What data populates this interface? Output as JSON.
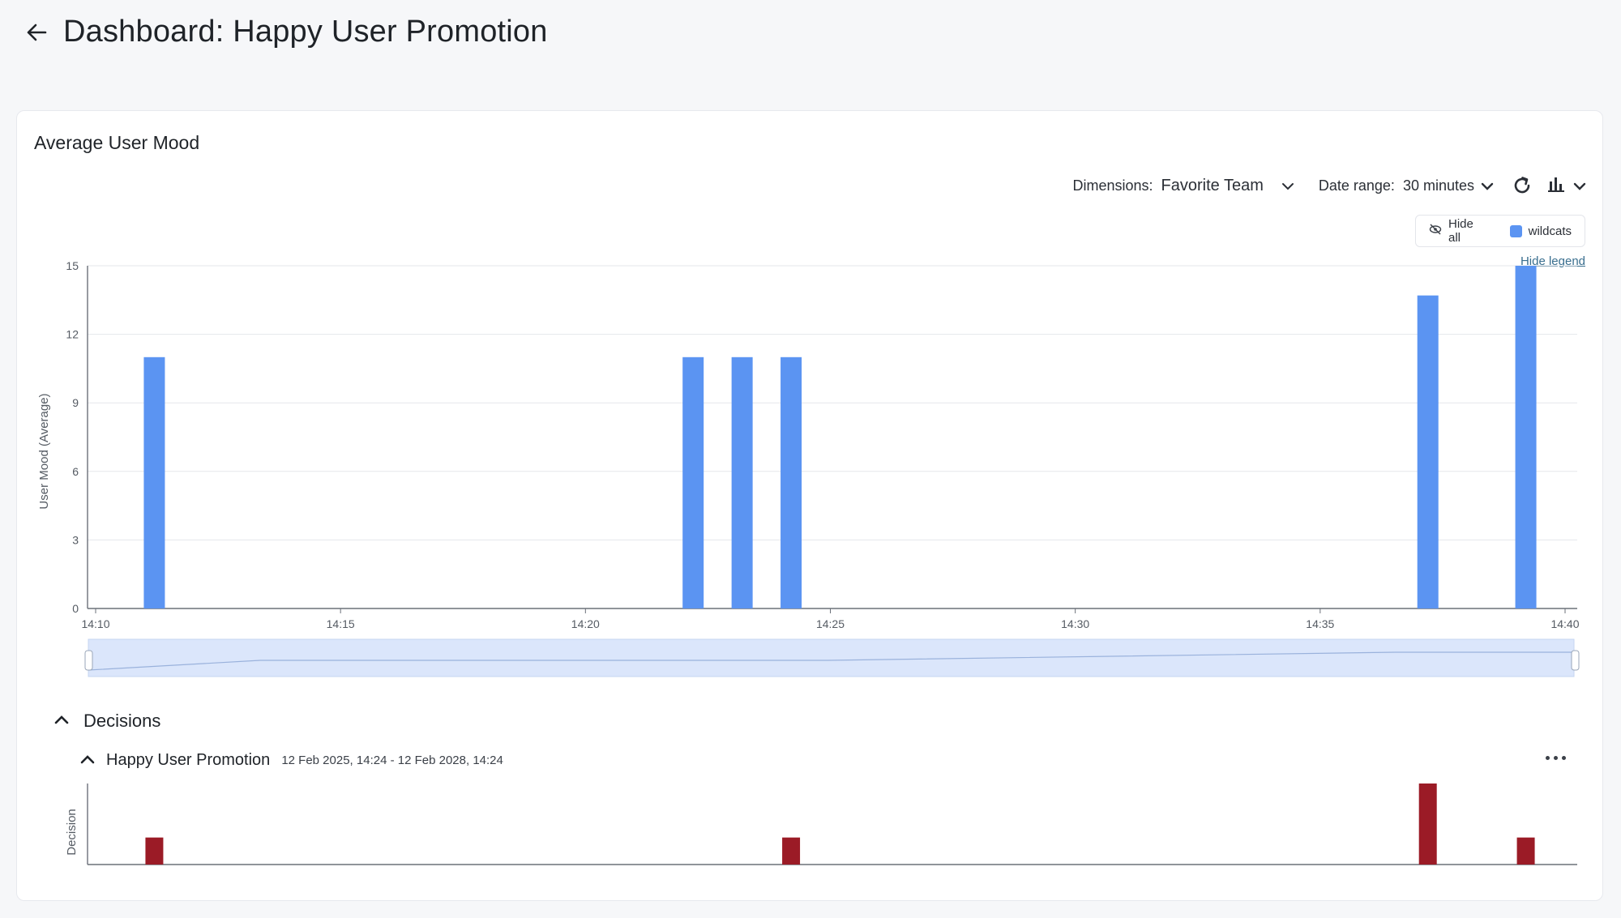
{
  "header": {
    "title": "Dashboard: Happy User Promotion"
  },
  "card": {
    "title": "Average User Mood",
    "toolbar": {
      "dimensions_label": "Dimensions:",
      "dimensions_value": "Favorite Team",
      "date_range_label": "Date range:",
      "date_range_value": "30 minutes"
    },
    "legend": {
      "hide_all_label": "Hide all",
      "series_label": "wildcats",
      "hide_legend_label": "Hide legend"
    }
  },
  "colors": {
    "accent": "#5b94f2",
    "decision": "#9b1b26",
    "grid": "#e5e7eb",
    "axis": "#9aa0a8",
    "navigator": "#dbe6fb"
  },
  "chart_data": [
    {
      "type": "bar",
      "ylabel": "User Mood (Average)",
      "ylim": [
        0,
        15
      ],
      "yticks": [
        0,
        3,
        6,
        9,
        12,
        15
      ],
      "xlim": [
        "14:10",
        "14:40"
      ],
      "xticks": [
        "14:10",
        "14:15",
        "14:20",
        "14:25",
        "14:30",
        "14:35",
        "14:40"
      ],
      "grid": true,
      "legend": "top-right",
      "series": [
        {
          "name": "wildcats",
          "color": "#5b94f2",
          "points": [
            {
              "x": "14:11",
              "y": 11
            },
            {
              "x": "14:22",
              "y": 11
            },
            {
              "x": "14:23",
              "y": 11
            },
            {
              "x": "14:24",
              "y": 11
            },
            {
              "x": "14:37",
              "y": 13.7
            },
            {
              "x": "14:39",
              "y": 15
            }
          ]
        }
      ]
    },
    {
      "type": "bar",
      "ylabel": "Decision",
      "xlim": [
        "14:10",
        "14:40"
      ],
      "series": [
        {
          "color": "#9b1b26",
          "points": [
            {
              "x": "14:11",
              "y": 1
            },
            {
              "x": "14:24",
              "y": 1
            },
            {
              "x": "14:37",
              "y": 3
            },
            {
              "x": "14:39",
              "y": 1
            }
          ]
        }
      ]
    }
  ],
  "decisions": {
    "title": "Decisions",
    "item": {
      "name": "Happy User Promotion",
      "dates": "12 Feb 2025, 14:24 - 12 Feb 2028, 14:24"
    }
  }
}
